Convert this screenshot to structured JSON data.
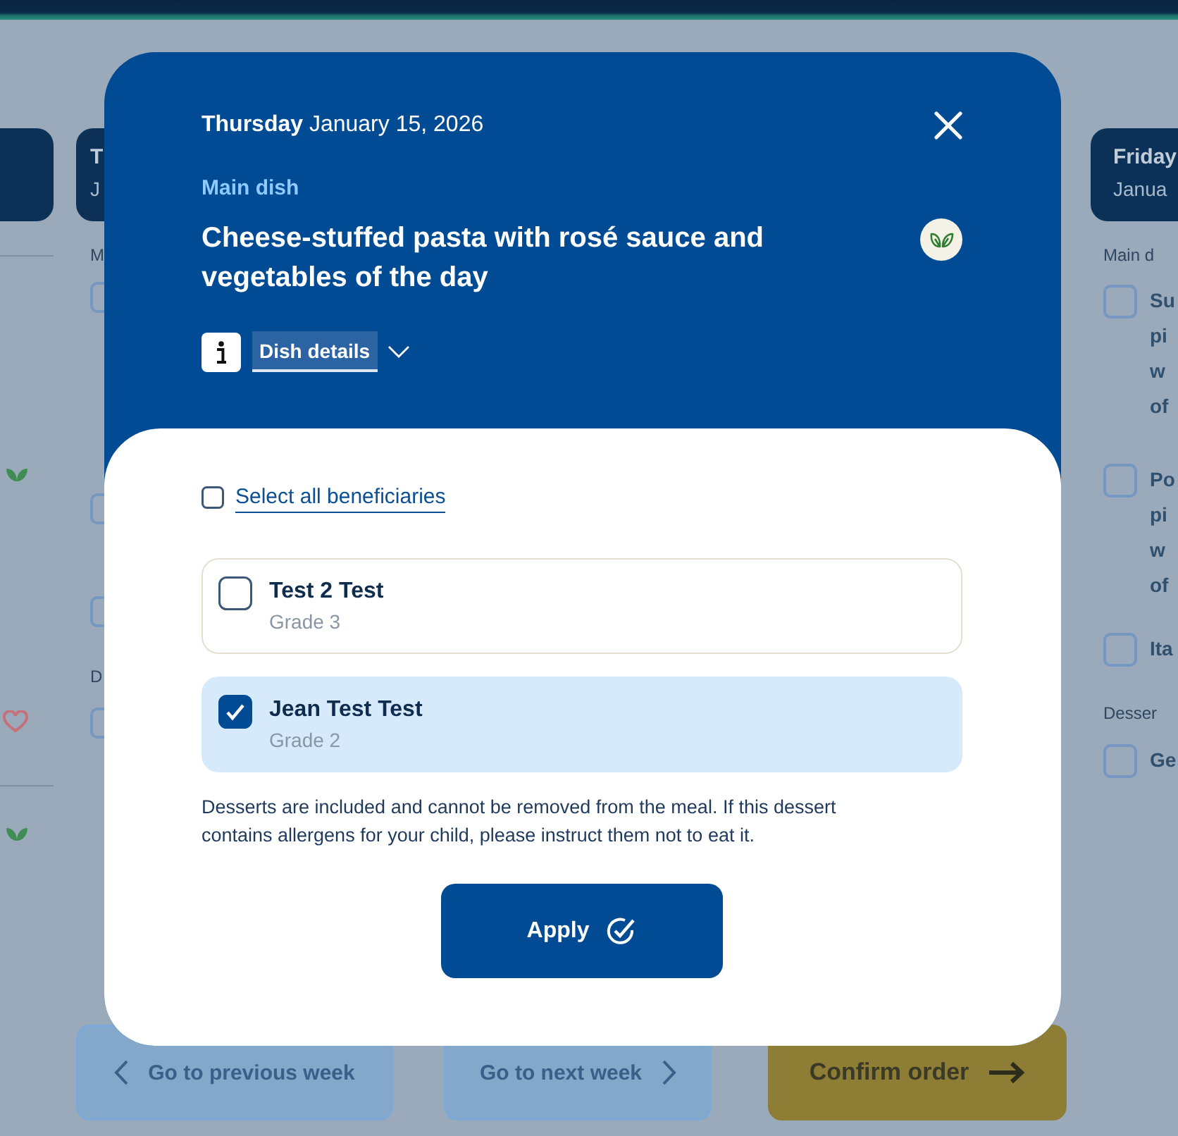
{
  "page": {
    "monday_column": {
      "items": [
        {
          "kind": "divider"
        },
        {
          "kind": "leaf"
        },
        {
          "kind": "heart"
        },
        {
          "kind": "divider"
        },
        {
          "kind": "leaf"
        }
      ]
    },
    "tuesday_column": {
      "day_card": {
        "weekday": "T",
        "date": "J"
      },
      "items": [
        {
          "kind": "label",
          "text": "M"
        },
        {
          "kind": "checkbox",
          "checked": false
        },
        {
          "kind": "checkbox",
          "checked": false
        },
        {
          "kind": "checkbox",
          "checked": false
        },
        {
          "kind": "label",
          "text": "D"
        },
        {
          "kind": "checkbox",
          "checked": false
        }
      ]
    },
    "friday_column": {
      "day_card": {
        "weekday": "Friday",
        "date": "Janua"
      },
      "items": [
        {
          "kind": "label",
          "text": "Main d"
        },
        {
          "kind": "dish",
          "checked": false,
          "lines": [
            "Su",
            "pi",
            "w",
            "of"
          ]
        },
        {
          "kind": "dish",
          "checked": false,
          "lines": [
            "Po",
            "pi",
            "w",
            "of"
          ]
        },
        {
          "kind": "dish",
          "checked": false,
          "lines": [
            "Ita"
          ]
        },
        {
          "kind": "label",
          "text": "Desser"
        },
        {
          "kind": "dish",
          "checked": false,
          "lines": [
            "Ge"
          ]
        }
      ]
    },
    "footer_buttons": [
      {
        "kind": "previous",
        "label": "Go to previous week"
      },
      {
        "kind": "next",
        "label": "Go to next week"
      },
      {
        "kind": "confirm",
        "label": "Confirm order"
      }
    ]
  },
  "dialog": {
    "date": "**Thursday** January 15, 2026",
    "course": "Main dish",
    "dish_name": "Cheese-stuffed pasta with rosé sauce and vegetables of the day",
    "details_toggle": {
      "label": "Dish details",
      "expanded": false
    },
    "select_all": {
      "label": "Select all beneficiaries",
      "checked": false
    },
    "beneficiaries": [
      {
        "name": "Test 2 Test",
        "grade": "Grade 3",
        "selected": false
      },
      {
        "name": "Jean Test Test",
        "grade": "Grade 2",
        "selected": true
      }
    ],
    "notice": "Desserts are included and cannot be removed from the meal. If this dessert contains allergens for your child, please instruct them not to eat it.",
    "apply_button": {
      "label": "Apply"
    }
  }
}
